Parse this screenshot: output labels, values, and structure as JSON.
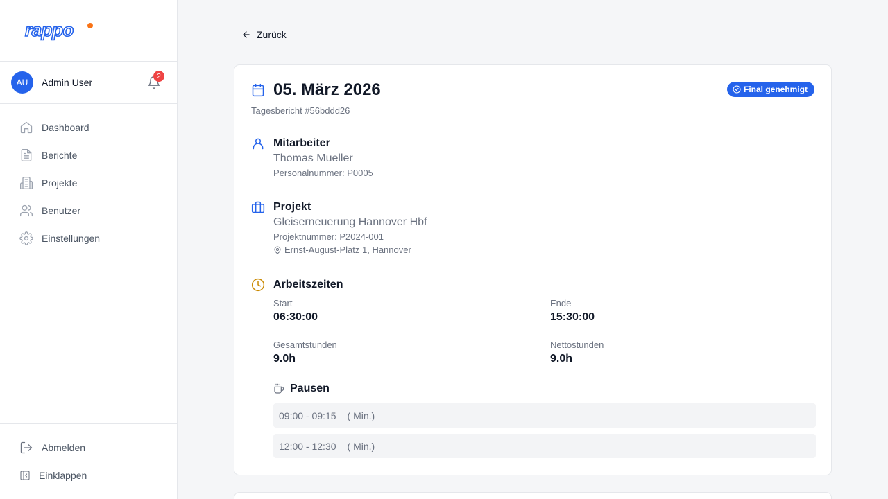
{
  "brand": {
    "name": "rappo",
    "accent": "#2563eb",
    "dot": "#f97316"
  },
  "user": {
    "initials": "AU",
    "name": "Admin User",
    "notifications": "2"
  },
  "nav": [
    {
      "label": "Dashboard",
      "icon": "home-icon"
    },
    {
      "label": "Berichte",
      "icon": "document-icon"
    },
    {
      "label": "Projekte",
      "icon": "building-icon"
    },
    {
      "label": "Benutzer",
      "icon": "users-icon"
    },
    {
      "label": "Einstellungen",
      "icon": "gear-icon"
    }
  ],
  "bottom_nav": [
    {
      "label": "Abmelden",
      "icon": "logout-icon"
    },
    {
      "label": "Einklappen",
      "icon": "collapse-icon"
    }
  ],
  "back_label": "Zurück",
  "report": {
    "date": "05. März 2026",
    "subtitle": "Tagesbericht #56bddd26",
    "status": "Final genehmigt",
    "employee": {
      "heading": "Mitarbeiter",
      "name": "Thomas Mueller",
      "personnel": "Personalnummer: P0005"
    },
    "project": {
      "heading": "Projekt",
      "name": "Gleiserneuerung Hannover Hbf",
      "number": "Projektnummer: P2024-001",
      "address": "Ernst-August-Platz 1, Hannover"
    },
    "times": {
      "heading": "Arbeitszeiten",
      "start_label": "Start",
      "start": "06:30:00",
      "end_label": "Ende",
      "end": "15:30:00",
      "total_label": "Gesamtstunden",
      "total": "9.0h",
      "net_label": "Nettostunden",
      "net": "9.0h"
    },
    "breaks": {
      "heading": "Pausen",
      "items": [
        {
          "range": "09:00 - 09:15",
          "minutes": "( Min.)"
        },
        {
          "range": "12:00 - 12:30",
          "minutes": "( Min.)"
        }
      ]
    }
  }
}
